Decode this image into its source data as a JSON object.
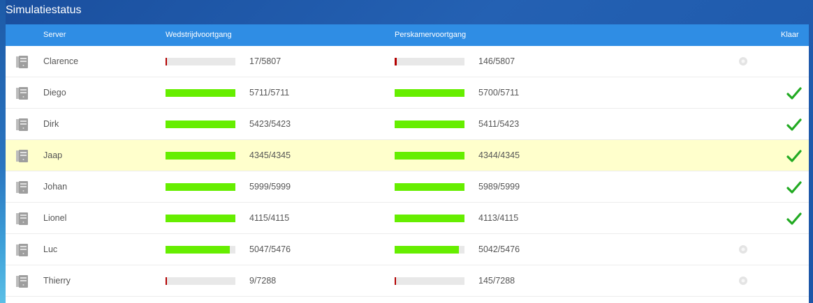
{
  "title": "Simulatiestatus",
  "columns": {
    "server": "Server",
    "match": "Wedstrijdvoortgang",
    "press": "Perskamervoortgang",
    "done": "Klaar"
  },
  "colors": {
    "header": "#2f8de4",
    "bar_complete": "#66ee00",
    "bar_low": "#b30000",
    "check": "#22aa22",
    "highlight": "#ffffcc"
  },
  "rows": [
    {
      "name": "Clarence",
      "match_done": 17,
      "match_total": 5807,
      "match_text": "17/5807",
      "press_done": 146,
      "press_total": 5807,
      "press_text": "146/5807",
      "status": "busy-icon",
      "highlight": false
    },
    {
      "name": "Diego",
      "match_done": 5711,
      "match_total": 5711,
      "match_text": "5711/5711",
      "press_done": 5700,
      "press_total": 5711,
      "press_text": "5700/5711",
      "status": "check-icon",
      "highlight": false
    },
    {
      "name": "Dirk",
      "match_done": 5423,
      "match_total": 5423,
      "match_text": "5423/5423",
      "press_done": 5411,
      "press_total": 5423,
      "press_text": "5411/5423",
      "status": "check-icon",
      "highlight": false
    },
    {
      "name": "Jaap",
      "match_done": 4345,
      "match_total": 4345,
      "match_text": "4345/4345",
      "press_done": 4344,
      "press_total": 4345,
      "press_text": "4344/4345",
      "status": "check-icon",
      "highlight": true
    },
    {
      "name": "Johan",
      "match_done": 5999,
      "match_total": 5999,
      "match_text": "5999/5999",
      "press_done": 5989,
      "press_total": 5999,
      "press_text": "5989/5999",
      "status": "check-icon",
      "highlight": false
    },
    {
      "name": "Lionel",
      "match_done": 4115,
      "match_total": 4115,
      "match_text": "4115/4115",
      "press_done": 4113,
      "press_total": 4115,
      "press_text": "4113/4115",
      "status": "check-icon",
      "highlight": false
    },
    {
      "name": "Luc",
      "match_done": 5047,
      "match_total": 5476,
      "match_text": "5047/5476",
      "press_done": 5042,
      "press_total": 5476,
      "press_text": "5042/5476",
      "status": "busy-icon",
      "highlight": false
    },
    {
      "name": "Thierry",
      "match_done": 9,
      "match_total": 7288,
      "match_text": "9/7288",
      "press_done": 145,
      "press_total": 7288,
      "press_text": "145/7288",
      "status": "busy-icon",
      "highlight": false
    }
  ]
}
